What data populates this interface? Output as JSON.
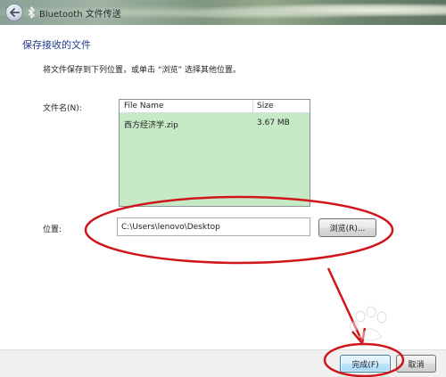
{
  "window": {
    "title": "Bluetooth 文件传送"
  },
  "heading": "保存接收的文件",
  "instruction": "将文件保存到下列位置，或单击 “浏览” 选择其他位置。",
  "file_list": {
    "label": "文件名(N):",
    "columns": [
      "File Name",
      "Size"
    ],
    "rows": [
      {
        "name": "西方经济学.zip",
        "size": "3.67 MB"
      }
    ],
    "background_color": "#c6eac6"
  },
  "location": {
    "label": "位置:",
    "path": "C:\\Users\\lenovo\\Desktop",
    "browse_label": "浏览(R)..."
  },
  "footer": {
    "finish_label": "完成(F)",
    "cancel_label": "取消"
  },
  "annotation": {
    "color": "#d0161b",
    "watermark_icon": "baidu-paw-icon"
  },
  "icons": {
    "back": "back-arrow-icon",
    "title": "bluetooth-icon"
  }
}
